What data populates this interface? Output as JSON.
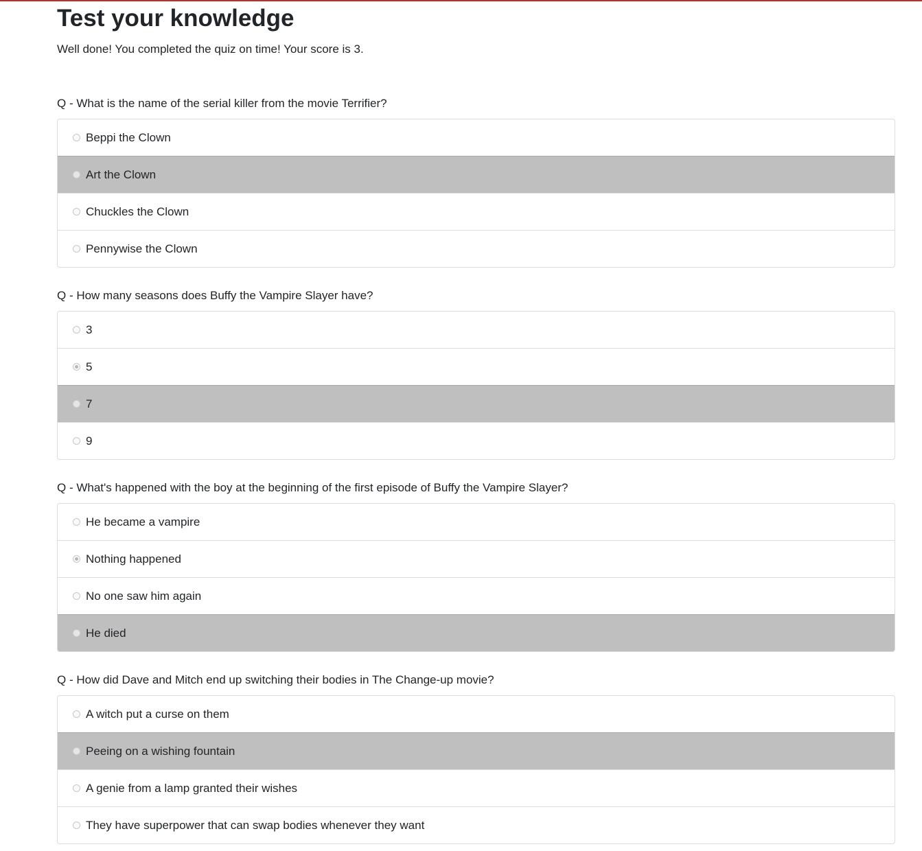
{
  "page": {
    "title": "Test your knowledge",
    "result": "Well done! You completed the quiz on time! Your score is 3."
  },
  "colors": {
    "correct_highlight": "#bfbfbf",
    "top_border": "#a33a32"
  },
  "questions": [
    {
      "text": "Q - What is the name of the serial killer from the movie Terrifier?",
      "answers": [
        {
          "label": "Beppi the Clown",
          "correct": false,
          "selected": false
        },
        {
          "label": "Art the Clown",
          "correct": true,
          "selected": false
        },
        {
          "label": "Chuckles the Clown",
          "correct": false,
          "selected": false
        },
        {
          "label": "Pennywise the Clown",
          "correct": false,
          "selected": false
        }
      ]
    },
    {
      "text": "Q - How many seasons does Buffy the Vampire Slayer have?",
      "answers": [
        {
          "label": "3",
          "correct": false,
          "selected": false
        },
        {
          "label": "5",
          "correct": false,
          "selected": true
        },
        {
          "label": "7",
          "correct": true,
          "selected": false
        },
        {
          "label": "9",
          "correct": false,
          "selected": false
        }
      ]
    },
    {
      "text": "Q - What's happened with the boy at the beginning of the first episode of Buffy the Vampire Slayer?",
      "answers": [
        {
          "label": "He became a vampire",
          "correct": false,
          "selected": false
        },
        {
          "label": "Nothing happened",
          "correct": false,
          "selected": true
        },
        {
          "label": "No one saw him again",
          "correct": false,
          "selected": false
        },
        {
          "label": "He died",
          "correct": true,
          "selected": false
        }
      ]
    },
    {
      "text": "Q - How did Dave and Mitch end up switching their bodies in The Change-up movie?",
      "answers": [
        {
          "label": "A witch put a curse on them",
          "correct": false,
          "selected": false
        },
        {
          "label": "Peeing on a wishing fountain",
          "correct": true,
          "selected": false
        },
        {
          "label": "A genie from a lamp granted their wishes",
          "correct": false,
          "selected": false
        },
        {
          "label": "They have superpower that can swap bodies whenever they want",
          "correct": false,
          "selected": false
        }
      ]
    }
  ]
}
